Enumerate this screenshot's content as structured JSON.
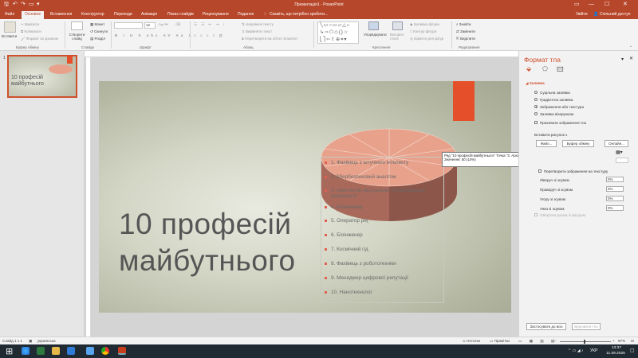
{
  "titlebar": {
    "title": "Презентація1 - PowerPoint",
    "minimize": "—",
    "maximize": "☐",
    "close": "✕"
  },
  "tabs": [
    {
      "label": "Файл"
    },
    {
      "label": "Основне"
    },
    {
      "label": "Вставлення"
    },
    {
      "label": "Конструктор"
    },
    {
      "label": "Переходи"
    },
    {
      "label": "Анімація"
    },
    {
      "label": "Показ слайдів"
    },
    {
      "label": "Рецензування"
    },
    {
      "label": "Подання"
    }
  ],
  "tell_me": "Скажіть, що потрібно зробити...",
  "sign_in": "Увійти",
  "share": "Спільний доступ",
  "ribbon": {
    "clipboard": {
      "paste": "Вставити",
      "cut": "Вирізати",
      "copy": "Копіювати",
      "format_painter": "Формат за зразком",
      "label": "Буфер обміну"
    },
    "slides": {
      "new_slide": "Створити слайд",
      "layout": "Макет",
      "reset": "Скинути",
      "section": "Розділ",
      "label": "Слайди"
    },
    "font": {
      "size": "12",
      "label": "Шрифт"
    },
    "paragraph": {
      "text_direction": "Напрямок тексту",
      "align_text": "Вирівняти текст",
      "smartart": "Перетворити на об'єкт SmartArt",
      "label": "Абзац"
    },
    "drawing": {
      "arrange": "Упорядкувати",
      "quick_styles": "Експрес-стилі",
      "shape_fill": "Заливка фігури",
      "shape_outline": "Контур фігури",
      "shape_effects": "Ефекти для фігур",
      "label": "Креслення"
    },
    "editing": {
      "find": "Знайти",
      "replace": "Замінити",
      "select": "Виділити",
      "label": "Редагування"
    }
  },
  "thumbnail": {
    "number": "1",
    "title": "10 професій майбутнього"
  },
  "slide": {
    "title_line1": "10 професій",
    "title_line2": "майбутнього",
    "legend": [
      "1. Фахівець з штучного інтелекту",
      "2.Кібербезпековий аналітик",
      "3. Архітектор віртуальної та доповненої реальності",
      "4. Біоінженер",
      "5. Оператор ре(",
      "6. Біоінженер",
      "7. Космічний гід",
      "8. Фахівець з робототехніки",
      "9. Менеджер цифрової репутації",
      "10. Нанотехнолог"
    ],
    "accent_color": "#e5502a",
    "pie_color": "#e8a28c"
  },
  "chart_data": {
    "type": "pie",
    "categories": [
      "1. Фахівець з штучного інтелекту",
      "2.Кібербезпековий аналітик",
      "3. Архітектор віртуальної та доповненої реальності",
      "4. Біоінженер",
      "5. Оператор ре(",
      "6. Біоінженер",
      "7. Космічний гід",
      "8. Фахівець з робототехніки",
      "9. Менеджер цифрової репутації",
      "10. Нанотехнолог"
    ],
    "series": [
      {
        "name": "10 професій майбутнього",
        "values": [
          50,
          50,
          50,
          50,
          50,
          50,
          50,
          50,
          50,
          50
        ]
      }
    ]
  },
  "tooltip": {
    "line1": "Ряд \"10 професій майбутнього\" Точка \"3. Архітектор віртуальної та доповненої реальності\"",
    "line2": "Значення: 50 (10%)"
  },
  "format_panel": {
    "title": "Формат тла",
    "section": "Заливка",
    "options": [
      "Суцільна заливка",
      "Градієнтна заливка",
      "Зображення або текстура",
      "Заливка візерунком"
    ],
    "hide_bg": "Приховати зображення тла",
    "insert_from": "Вставити рисунок з",
    "file_btn": "Файл...",
    "clipboard_btn": "Буфер обміну",
    "online_btn": "Онлайн...",
    "tile": "Перетворити зображення на текстуру",
    "offsets": [
      {
        "label": "Ліворуч зі зсувом",
        "value": "0%"
      },
      {
        "label": "Праворуч зі зсувом",
        "value": "0%"
      },
      {
        "label": "Угору зі зсувом",
        "value": "0%"
      },
      {
        "label": "Униз зі зсувом",
        "value": "0%"
      }
    ],
    "rotate": "Обертати разом із фігурою",
    "apply_all": "Застосувати до всіх",
    "reset_bg": "Відновити тло"
  },
  "status": {
    "slide": "Слайд 1 з 1",
    "language": "українська",
    "notes": "Нотатки",
    "comments": "Примітки",
    "zoom": "97%"
  },
  "taskbar": {
    "lang": "УКР",
    "time": "13:37",
    "date": "11.09.2025"
  }
}
